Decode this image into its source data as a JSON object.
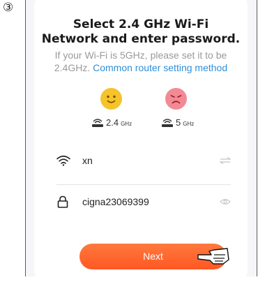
{
  "step_marker": "③",
  "title_line1": "Select 2.4 GHz Wi-Fi",
  "title_line2": "Network and enter password.",
  "subtitle_line1": "If your Wi-Fi is 5GHz, please set it to be",
  "subtitle_prefix": "2.4GHz.",
  "subtitle_link": "Common router setting method",
  "bands": {
    "supported": {
      "number": "2.4",
      "unit": "GHz",
      "face": "happy-face-icon",
      "color": "#f5c32a"
    },
    "unsupported": {
      "number": "5",
      "unit": "GHz",
      "face": "sad-face-icon",
      "color": "#f38a93"
    }
  },
  "ssid_field": {
    "value": "xn",
    "icon": "wifi-icon",
    "action_icon": "switch-network-icon"
  },
  "password_field": {
    "value": "cigna23069399",
    "icon": "lock-icon",
    "action_icon": "eye-icon"
  },
  "next_button": {
    "label": "Next",
    "color": "#ff5a26"
  },
  "pointer": "pointing-hand-icon"
}
